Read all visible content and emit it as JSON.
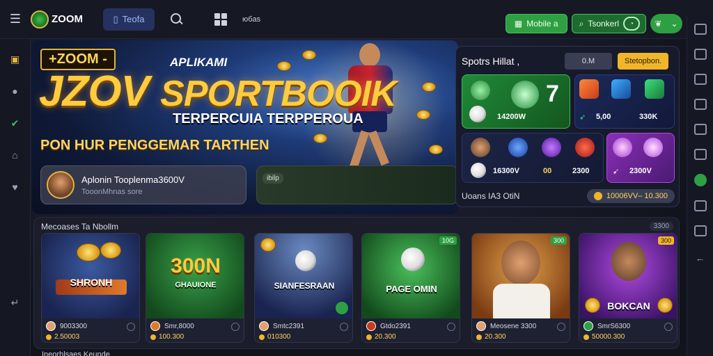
{
  "topbar": {
    "logo_text": "ZOOM",
    "active_tab_label": "Teofa",
    "extra_label": "юбas",
    "btn_primary_label": "Mobile a",
    "btn_secondary_label": "Tsonkerl",
    "colors": {
      "accent": "#2ea043",
      "tab_active": "#25315e",
      "gold": "#f0b52a"
    }
  },
  "hero": {
    "tag": "+ZOOM -",
    "subtitle": "APLIKAMI",
    "headline_1": "JZOV",
    "headline_2": "SPORTBOOIK",
    "line_1": "TERPERCUIA TERPPEROUA",
    "line_2": "PON HUR PENGGEMAR TARTHEN",
    "card_title": "Aplonin Tooplenma3600V",
    "card_sub": "TooonMhnas sore",
    "card2_badge": "ibilp"
  },
  "sports_panel": {
    "title": "Spotrs Hillat ,",
    "chip": "0.M",
    "button": "Stetopbon.",
    "tiles": [
      {
        "big_number": "7",
        "value": "14200W"
      },
      {
        "value": "5,00"
      },
      {
        "value": "330K"
      },
      {
        "value": "16300V"
      },
      {
        "value": "00"
      },
      {
        "value": "2300"
      },
      {
        "value": "2300V"
      }
    ],
    "footer_label": "Uoans IA3 OtiN",
    "footer_value": "10006VV– 10.300"
  },
  "games": {
    "section_title": "Mecoases Ta Nbollm",
    "count_badge": "3300",
    "cards": [
      {
        "label": "SHRONH",
        "title": "9003300",
        "price": "2.50003"
      },
      {
        "label": "300N",
        "sublabel": "GHAUIONE",
        "title": "Smr,8000",
        "price": "100.300"
      },
      {
        "label": "SIANFESRAAN",
        "title": "Smtc2391",
        "price": "010300"
      },
      {
        "label": "PAGE OMIN",
        "tag": "10G",
        "title": "Gtdo2391",
        "price": "20.300"
      },
      {
        "label": "",
        "tag": "300",
        "title": "Meosene 3300",
        "price": "20.300"
      },
      {
        "label": "BOKCAN",
        "tag": "300",
        "title": "SmrS6300",
        "price": "50000.300"
      }
    ],
    "bottom_label": "Ineorhlsaes Keunde"
  }
}
